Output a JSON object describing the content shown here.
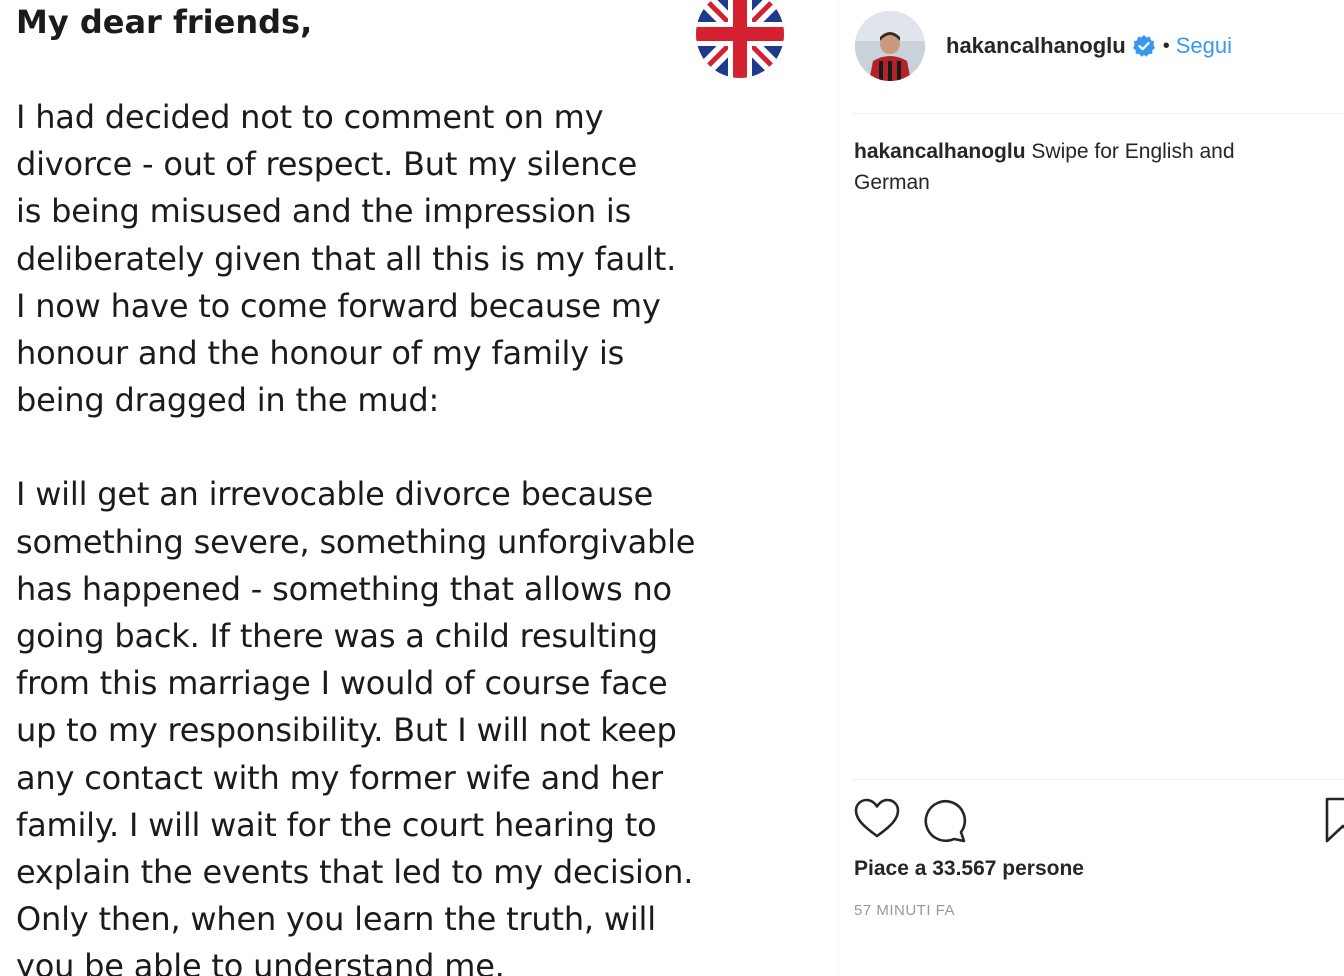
{
  "post": {
    "heading": "My dear friends,",
    "paragraphs": [
      [
        "I had decided not to comment on my",
        "divorce - out of respect. But my silence",
        "is being misused and the impression is",
        "deliberately given that all this is my fault.",
        "I now have to come forward because my",
        "honour and the honour of my family is",
        "being dragged in the mud:"
      ],
      [
        "I will get an irrevocable divorce because",
        "something severe, something unforgivable",
        "has happened - something that allows no",
        "going back. If there was a child resulting",
        "from this marriage I would of course face",
        "up to my responsibility. But I will not keep",
        "any contact with my former wife and her",
        "family. I will wait for the court hearing to",
        "explain the events that led to my decision.",
        "Only then, when you learn the truth, will",
        "you be able to understand me."
      ]
    ],
    "flag_icon": "uk-flag-icon"
  },
  "profile": {
    "username": "hakancalhanoglu",
    "verified_icon": "verified-badge-icon",
    "separator": "•",
    "follow_label": "Segui",
    "accent_color": "#3897f0"
  },
  "caption": {
    "username": "hakancalhanoglu",
    "text": "Swipe for English and German"
  },
  "actions": {
    "like_icon": "heart-icon",
    "comment_icon": "comment-icon",
    "save_icon": "bookmark-icon",
    "likes_text": "Piace a 33.567 persone",
    "timestamp": "57 MINUTI FA"
  }
}
